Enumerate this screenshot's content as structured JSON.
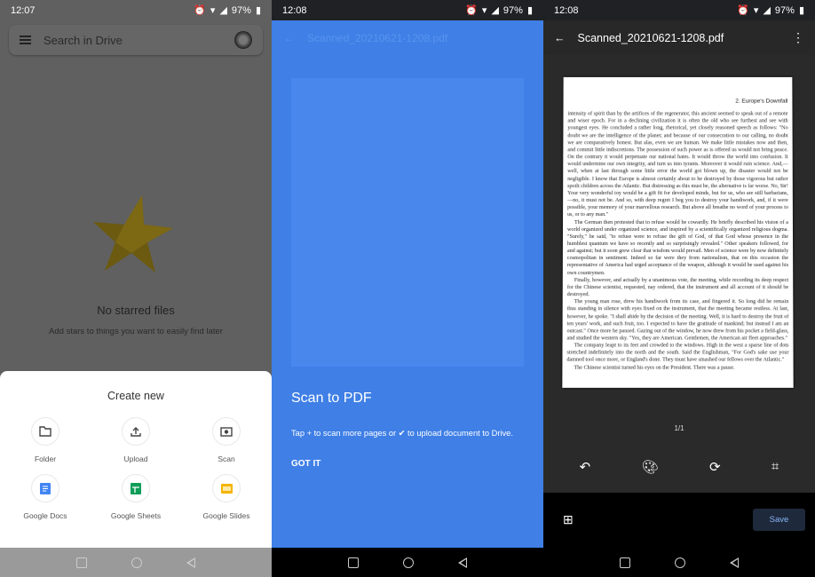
{
  "screen1": {
    "status": {
      "time": "12:07",
      "battery": "97%"
    },
    "search": {
      "placeholder": "Search in Drive"
    },
    "empty": {
      "title": "No starred files",
      "subtitle": "Add stars to things you want to easily find later"
    },
    "sheet": {
      "title": "Create new",
      "items": [
        {
          "label": "Folder",
          "icon": "folder-icon"
        },
        {
          "label": "Upload",
          "icon": "upload-icon"
        },
        {
          "label": "Scan",
          "icon": "camera-icon"
        },
        {
          "label": "Google Docs",
          "icon": "google-docs-icon",
          "color": "#4285f4"
        },
        {
          "label": "Google Sheets",
          "icon": "google-sheets-icon",
          "color": "#0f9d58"
        },
        {
          "label": "Google Slides",
          "icon": "google-slides-icon",
          "color": "#f4b400"
        }
      ]
    }
  },
  "screen2": {
    "status": {
      "time": "12:08",
      "battery": "97%"
    },
    "file_title": "Scanned_20210621-1208.pdf",
    "overlay": {
      "title": "Scan to PDF",
      "text": "Tap + to scan more pages or ✔ to upload document to Drive.",
      "button": "GOT IT"
    },
    "accent": "#3f7fe6"
  },
  "screen3": {
    "status": {
      "time": "12:08",
      "battery": "97%"
    },
    "file_title": "Scanned_20210621-1208.pdf",
    "document": {
      "header": "2. Europe's Downfall",
      "paragraphs": [
        "intensity of spirit than by the artifices of the regenerator, this ancient seemed to speak out of a remote and wiser epoch. For in a declining civilization it is often the old who see furthest and see with youngest eyes. He concluded a rather long, rhetorical, yet closely reasoned speech as follows: \"No doubt we are the intelligence of the planet; and because of our consecration to our calling, no doubt we are comparatively honest. But alas, even we are human. We make little mistakes now and then, and commit little indiscretions. The possession of such power as is offered us would not bring peace. On the contrary it would perpetuate our national hates. It would throw the world into confusion. It would undermine our own integrity, and turn us into tyrants. Moreover it would ruin science. And,—well, when at last through some little error the world got blown up, the disaster would not be negligible. I know that Europe is almost certainly about to be destroyed by those vigorous but rather spoilt children across the Atlantic. But distressing as this must be, the alternative is far worse. No, Sir! Your very wonderful toy would be a gift fit for developed minds, but for us, who are still barbarians,—no, it must not be. And so, with deep regret I beg you to destroy your handiwork, and, if it were possible, your memory of your marvellous research. But above all breathe no word of your process to us, or to any man.\"",
        "The German then protested that to refuse would be cowardly. He briefly described his vision of a world organized under organized science, and inspired by a scientifically organized religious dogma. \"Surely,\" he said, \"to refuse were to refuse the gift of God, of that God whose presence in the humblest quantum we have so recently and so surprisingly revealed.\" Other speakers followed, for and against; but it soon grew clear that wisdom would prevail. Men of science were by now definitely cosmopolitan in sentiment. Indeed so far were they from nationalism, that on this occasion the representative of America had urged acceptance of the weapon, although it would be used against his own countrymen.",
        "Finally, however, and actually by a unanimous vote, the meeting, while recording its deep respect for the Chinese scientist, requested, nay ordered, that the instrument and all account of it should be destroyed.",
        "The young man rose, drew his handiwork from its case, and fingered it. So long did he remain thus standing in silence with eyes fixed on the instrument, that the meeting became restless. At last, however, he spoke. \"I shall abide by the decision of the meeting. Well, it is hard to destroy the fruit of ten years' work, and such fruit, too. I expected to have the gratitude of mankind; but instead I am an outcast.\" Once more he paused. Gazing out of the window, he now drew from his pocket a field-glass, and studied the western sky. \"Yes, they are American. Gentlemen, the American air fleet approaches.\"",
        "The company leapt to its feet and crowded to the windows. High in the west a sparse line of dots stretched indefinitely into the north and the south. Said the Englishman, \"For God's sake use your damned tool once more, or England's done. They must have smashed our fellows over the Atlantic.\"",
        "The Chinese scientist turned his eyes on the President. There was a pause."
      ]
    },
    "page_count": "1/1",
    "tools": [
      "undo-icon",
      "palette-icon",
      "rotate-icon",
      "crop-icon"
    ],
    "save_label": "Save"
  }
}
